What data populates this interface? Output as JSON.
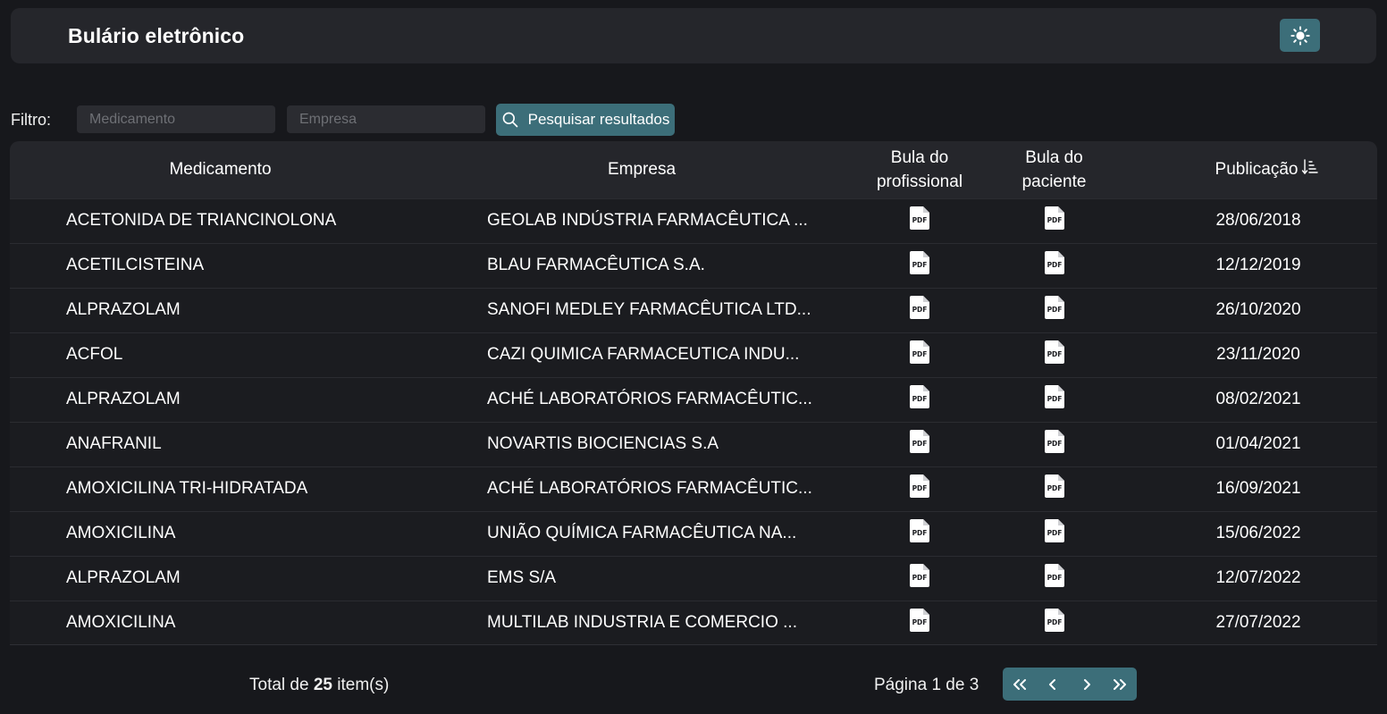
{
  "header": {
    "title": "Bulário eletrônico",
    "theme_toggle_icon": "sun-icon"
  },
  "filter": {
    "label": "Filtro:",
    "medicamento_placeholder": "Medicamento",
    "medicamento_value": "",
    "empresa_placeholder": "Empresa",
    "empresa_value": "",
    "search_button_label": "Pesquisar resultados",
    "search_icon": "search-icon"
  },
  "table": {
    "columns": {
      "medicamento": "Medicamento",
      "empresa": "Empresa",
      "bula_profissional_line1": "Bula do",
      "bula_profissional_line2": "profissional",
      "bula_paciente_line1": "Bula do",
      "bula_paciente_line2": "paciente",
      "publicacao": "Publicação",
      "publicacao_sort_icon": "sort-ascending-icon"
    },
    "pdf_icon": "pdf-file-icon",
    "rows": [
      {
        "medicamento": "ACETONIDA DE TRIANCINOLONA",
        "empresa": "GEOLAB INDÚSTRIA FARMACÊUTICA ...",
        "data": "28/06/2018"
      },
      {
        "medicamento": "ACETILCISTEINA",
        "empresa": "BLAU FARMACÊUTICA S.A.",
        "data": "12/12/2019"
      },
      {
        "medicamento": "ALPRAZOLAM",
        "empresa": "SANOFI MEDLEY FARMACÊUTICA LTD...",
        "data": "26/10/2020"
      },
      {
        "medicamento": "ACFOL",
        "empresa": "CAZI QUIMICA FARMACEUTICA INDU...",
        "data": "23/11/2020"
      },
      {
        "medicamento": "ALPRAZOLAM",
        "empresa": "ACHÉ LABORATÓRIOS FARMACÊUTIC...",
        "data": "08/02/2021"
      },
      {
        "medicamento": "ANAFRANIL",
        "empresa": "NOVARTIS BIOCIENCIAS S.A",
        "data": "01/04/2021"
      },
      {
        "medicamento": "AMOXICILINA TRI-HIDRATADA",
        "empresa": "ACHÉ LABORATÓRIOS FARMACÊUTIC...",
        "data": "16/09/2021"
      },
      {
        "medicamento": "AMOXICILINA",
        "empresa": "UNIÃO QUÍMICA FARMACÊUTICA NA...",
        "data": "15/06/2022"
      },
      {
        "medicamento": "ALPRAZOLAM",
        "empresa": "EMS S/A",
        "data": "12/07/2022"
      },
      {
        "medicamento": "AMOXICILINA",
        "empresa": "MULTILAB INDUSTRIA E COMERCIO ...",
        "data": "27/07/2022"
      }
    ]
  },
  "footer": {
    "total_prefix": "Total de",
    "total_count": "25",
    "total_suffix": "item(s)",
    "page_label": "Página 1 de 3",
    "pager_icons": [
      "first-page-icon",
      "previous-page-icon",
      "next-page-icon",
      "last-page-icon"
    ]
  },
  "colors": {
    "background": "#17181c",
    "panel": "#25262b",
    "accent": "#3c6e79"
  }
}
